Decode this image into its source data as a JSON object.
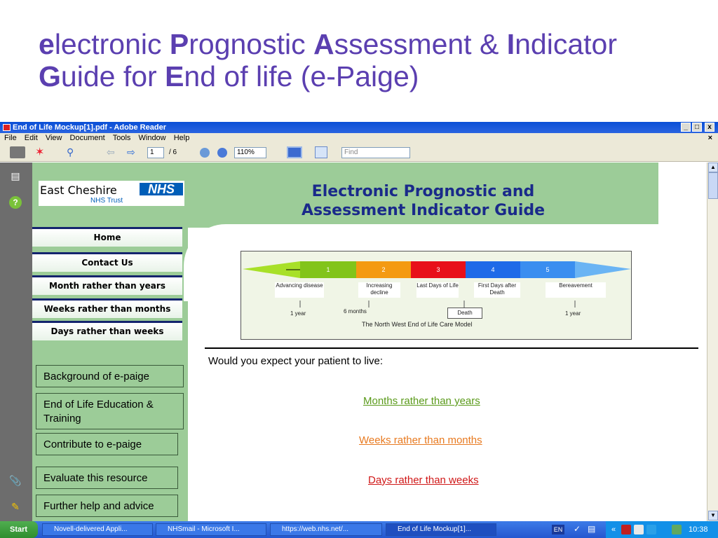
{
  "slide": {
    "title_line1": [
      {
        "b": "e",
        "t": "lectronic "
      },
      {
        "b": "P",
        "t": "rognostic "
      },
      {
        "b": "A",
        "t": "ssessment & "
      },
      {
        "b": "I",
        "t": "ndicator"
      }
    ],
    "title_line2": [
      {
        "b": "G",
        "t": "uide for "
      },
      {
        "b": "E",
        "t": "nd of life (e-Paige)"
      }
    ]
  },
  "window": {
    "title": "End of Life Mockup[1].pdf - Adobe Reader",
    "controls": [
      "_",
      "̅",
      "x"
    ]
  },
  "menu": [
    "File",
    "Edit",
    "View",
    "Document",
    "Tools",
    "Window",
    "Help"
  ],
  "toolbar": {
    "page_current": "1",
    "page_total": "/ 6",
    "zoom": "110%",
    "find_placeholder": "Find"
  },
  "pdf": {
    "logo": {
      "org": "East Cheshire",
      "nhs": "NHS",
      "trust": "NHS Trust"
    },
    "header_title_line1": "Electronic Prognostic and",
    "header_title_line2": "Assessment Indicator Guide",
    "nav": [
      "Home",
      "Contact Us",
      "Month rather than years",
      "Weeks rather than months",
      "Days rather than weeks"
    ],
    "links": [
      "Background of e-paige",
      "End of Life Education & Training",
      "Contribute to  e-paige",
      "Evaluate this resource",
      "Further help and advice"
    ],
    "diagram": {
      "stages": [
        "1",
        "2",
        "3",
        "4",
        "5"
      ],
      "labels": [
        "Advancing disease",
        "Increasing decline",
        "Last Days of Life",
        "First Days after Death",
        "Bereavement"
      ],
      "time_left": "1 year",
      "time_mid": "6 months",
      "death": "Death",
      "time_right": "1 year",
      "caption": "The North West End of Life Care Model"
    },
    "question": "Would you expect your patient to live:",
    "options": [
      {
        "text": "Months rather than years",
        "color": "#5a9a1a"
      },
      {
        "text": "Weeks rather than months",
        "color": "#e87a20"
      },
      {
        "text": "Days rather than weeks",
        "color": "#d01818"
      }
    ]
  },
  "taskbar": {
    "start": "Start",
    "tasks": [
      "Novell-delivered Appli...",
      "NHSmail - Microsoft I...",
      "https://web.nhs.net/...",
      "End of Life Mockup[1]..."
    ],
    "lang": "EN",
    "time": "10:38"
  }
}
